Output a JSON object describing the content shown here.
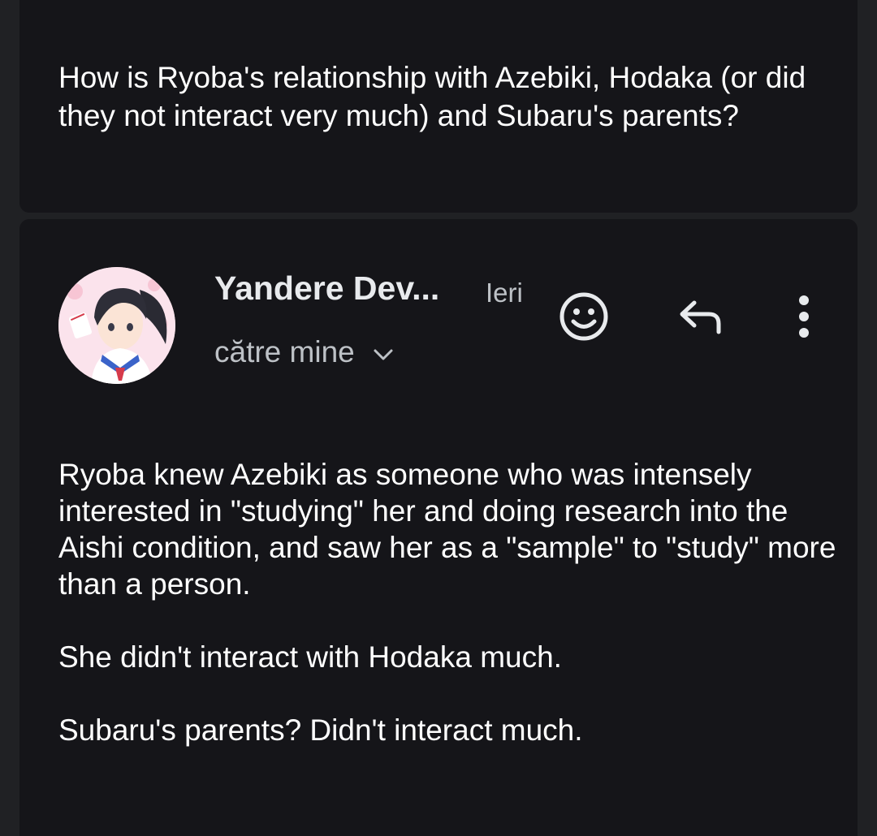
{
  "question": {
    "text": "How is Ryoba's relationship with Azebiki, Hodaka (or did they not interact very much) and Subaru's parents?"
  },
  "message": {
    "sender_name": "Yandere Dev...",
    "time": "Ieri",
    "recipient_label": "către mine",
    "paragraphs": [
      "Ryoba knew Azebiki as someone who was intensely interested in \"studying\" her and doing research into the Aishi condition, and saw her as a \"sample\" to \"study\" more than a person.",
      "She didn't interact with Hodaka much.",
      "Subaru's parents? Didn't interact much."
    ]
  },
  "icons": {
    "emoji": "smiley-face-icon",
    "reply": "reply-arrow-icon",
    "more": "more-vertical-icon",
    "expand": "chevron-down-icon"
  },
  "colors": {
    "card": "#151519",
    "background": "#202124",
    "text": "#ffffff",
    "secondary_text": "#bdc1c6",
    "icon": "#e8eaed"
  }
}
